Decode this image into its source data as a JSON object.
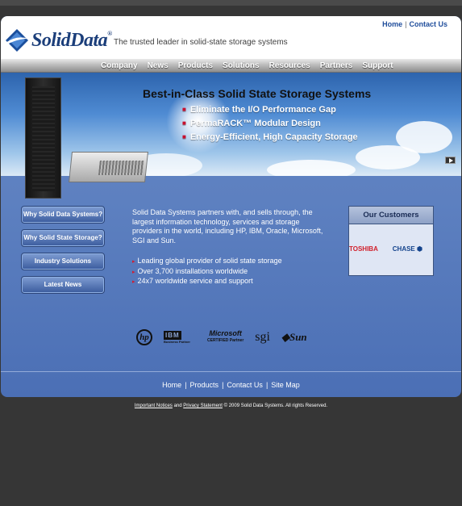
{
  "header": {
    "logo_text": "SolidData",
    "logo_mark": "®",
    "tagline": "The trusted leader in solid-state storage systems",
    "top_links": [
      "Home",
      "Contact Us"
    ]
  },
  "nav": {
    "items": [
      "Company",
      "News",
      "Products",
      "Solutions",
      "Resources",
      "Partners",
      "Support"
    ]
  },
  "hero": {
    "title": "Best-in-Class Solid State Storage Systems",
    "bullets": [
      "Eliminate the I/O Performance Gap",
      "PermaRACK™ Modular Design",
      "Energy-Efficient, High Capacity Storage"
    ],
    "play_icon": "play-icon"
  },
  "sidebar": {
    "buttons": [
      "Why Solid Data Systems?",
      "Why Solid State Storage?",
      "Industry Solutions",
      "Latest News"
    ]
  },
  "main": {
    "intro": "Solid Data Systems partners with, and sells through, the largest information technology, services and storage providers in the world, including HP, IBM, Oracle, Microsoft, SGI and Sun.",
    "list": [
      "Leading global provider of solid state storage",
      "Over 3,700 installations worldwide",
      "24x7 worldwide service and support"
    ]
  },
  "customers": {
    "title": "Our Customers",
    "logos": [
      "TOSHIBA",
      "CHASE"
    ]
  },
  "partners": {
    "hp": "hp",
    "ibm": "IBM",
    "ibm_sub": "Business Partner",
    "microsoft": "Microsoft",
    "microsoft_sub": "CERTIFIED Partner",
    "sgi": "sgi",
    "sun": "Sun"
  },
  "footer": {
    "links": [
      "Home",
      "Products",
      "Contact Us",
      "Site Map"
    ],
    "notices": "Important Notices",
    "and": "and",
    "privacy": "Privacy Statement",
    "copyright": "© 2009 Solid Data Systems. All rights Reserved."
  },
  "colors": {
    "brand_blue": "#1b3e7a",
    "accent_red": "#c8102e",
    "page_bg": "#363636"
  }
}
